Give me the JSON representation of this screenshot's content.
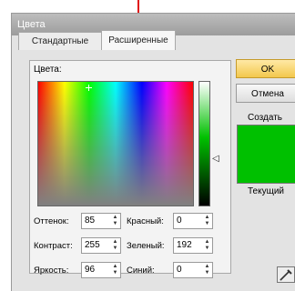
{
  "window": {
    "title": "Цвета"
  },
  "tabs": [
    {
      "label": "Стандартные",
      "active": false
    },
    {
      "label": "Расширенные",
      "active": true
    }
  ],
  "colors_label": "Цвета:",
  "fields": {
    "hue": {
      "label": "Оттенок:",
      "value": "85"
    },
    "saturation": {
      "label": "Контраст:",
      "value": "255"
    },
    "luminance": {
      "label": "Яркость:",
      "value": "96"
    },
    "red": {
      "label": "Красный:",
      "value": "0"
    },
    "green": {
      "label": "Зеленый:",
      "value": "192"
    },
    "blue": {
      "label": "Синий:",
      "value": "0"
    }
  },
  "buttons": {
    "ok": "OK",
    "cancel": "Отмена"
  },
  "preview": {
    "new_label": "Создать",
    "current_label": "Текущий",
    "color": "#00c000"
  },
  "colors": {
    "accent_annotation": "#e01010",
    "ok_button": "#f3c84d"
  },
  "icons": {
    "eyedropper": "eyedropper-icon",
    "luminance_pointer": "triangle-left-icon"
  }
}
